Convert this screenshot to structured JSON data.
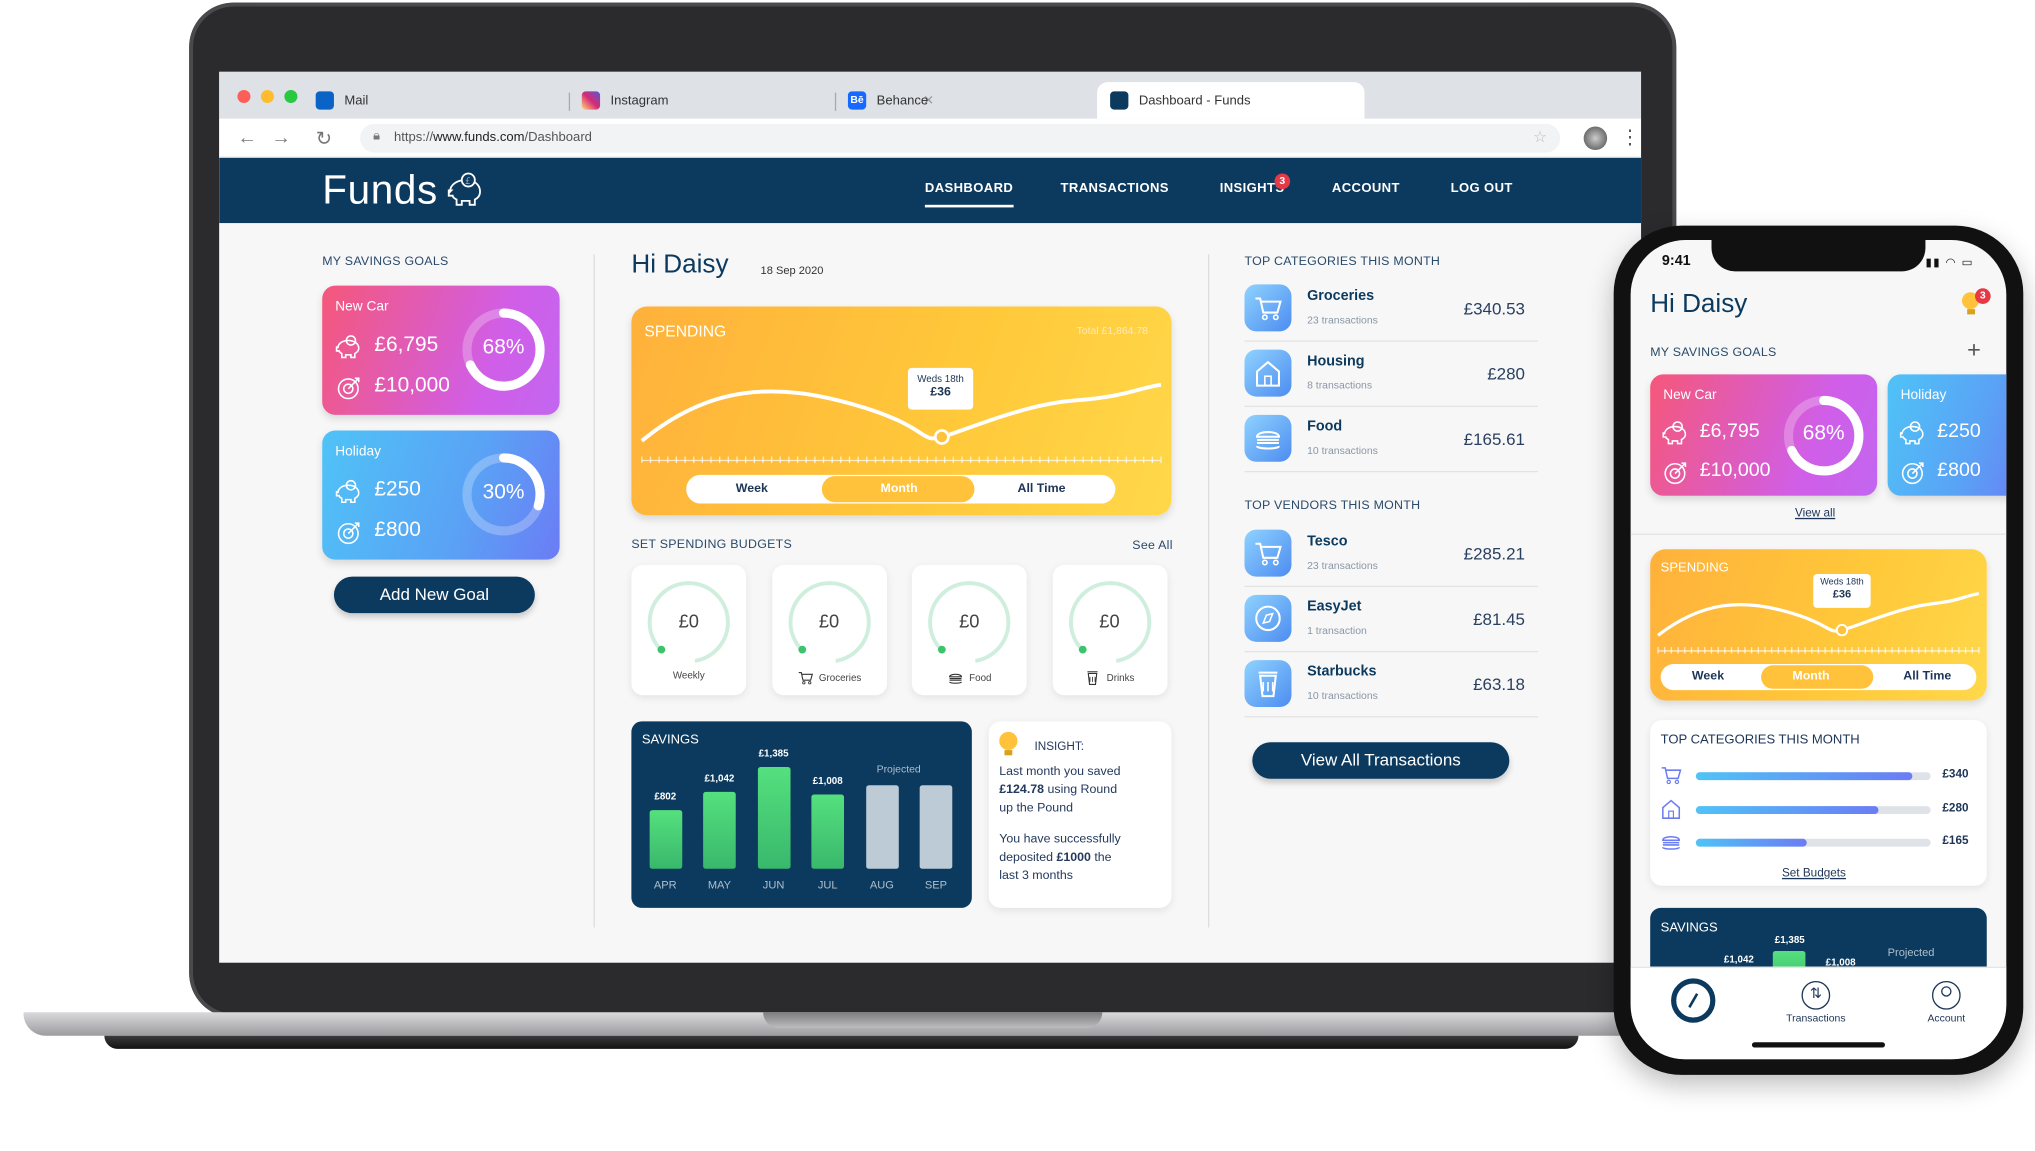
{
  "browser": {
    "tabs": [
      {
        "label": "Mail",
        "color": "#0a64c8"
      },
      {
        "label": "Instagram",
        "color": "#d6249f"
      },
      {
        "label": "Behance",
        "color": "#1769ff"
      },
      {
        "label": "Dashboard - Funds",
        "color": "#0c3a5e"
      }
    ],
    "url_prefix": "https://",
    "url_domain": "www.funds.com",
    "url_path": "/Dashboard"
  },
  "app": {
    "logo": "Funds",
    "nav": [
      "DASHBOARD",
      "TRANSACTIONS",
      "INSIGHTS",
      "ACCOUNT",
      "LOG OUT"
    ],
    "insights_badge": "3",
    "greeting": "Hi Daisy",
    "date": "18 Sep 2020"
  },
  "savings_goals": {
    "title": "MY SAVINGS GOALS",
    "goals": [
      {
        "name": "New Car",
        "saved": "£6,795",
        "target": "£10,000",
        "percent": "68%",
        "fraction": 0.68
      },
      {
        "name": "Holiday",
        "saved": "£250",
        "target": "£800",
        "percent": "30%",
        "fraction": 0.3
      }
    ],
    "add_button": "Add New Goal"
  },
  "spending": {
    "title": "SPENDING",
    "total": "Total £1,864.78",
    "tooltip_day": "Weds 18th",
    "tooltip_amount": "£36",
    "ranges": [
      "Week",
      "Month",
      "All Time"
    ],
    "selected": "Month"
  },
  "budgets": {
    "title": "SET SPENDING BUDGETS",
    "see_all": "See All",
    "items": [
      {
        "amount": "£0",
        "label": "Weekly",
        "icon": "none"
      },
      {
        "amount": "£0",
        "label": "Groceries",
        "icon": "cart-icon"
      },
      {
        "amount": "£0",
        "label": "Food",
        "icon": "burger-icon"
      },
      {
        "amount": "£0",
        "label": "Drinks",
        "icon": "drink-icon"
      }
    ]
  },
  "savings_chart": {
    "title": "SAVINGS",
    "projected_label": "Projected"
  },
  "chart_data": {
    "type": "bar",
    "title": "SAVINGS",
    "categories": [
      "APR",
      "MAY",
      "JUN",
      "JUL",
      "AUG",
      "SEP"
    ],
    "values": [
      802,
      1042,
      1385,
      1008,
      null,
      null
    ],
    "value_labels": [
      "£802",
      "£1,042",
      "£1,385",
      "£1,008",
      "",
      ""
    ],
    "projected": [
      false,
      false,
      false,
      false,
      true,
      true
    ],
    "ylim": [
      0,
      1500
    ]
  },
  "insight": {
    "title": "INSIGHT:",
    "line1": "Last month you saved",
    "amount1": "£124.78",
    "line2": " using Round",
    "line3": "up the Pound",
    "line4": "You have successfully",
    "line5": "deposited ",
    "amount2": "£1000",
    "line6": " the",
    "line7": "last 3 months"
  },
  "top_categories": {
    "title": "TOP CATEGORIES THIS MONTH",
    "items": [
      {
        "name": "Groceries",
        "sub": "23 transactions",
        "amount": "£340.53",
        "icon": "cart-icon"
      },
      {
        "name": "Housing",
        "sub": "8 transactions",
        "amount": "£280",
        "icon": "house-icon"
      },
      {
        "name": "Food",
        "sub": "10 transactions",
        "amount": "£165.61",
        "icon": "burger-icon"
      }
    ]
  },
  "top_vendors": {
    "title": "TOP VENDORS THIS MONTH",
    "items": [
      {
        "name": "Tesco",
        "sub": "23 transactions",
        "amount": "£285.21",
        "icon": "cart-icon"
      },
      {
        "name": "EasyJet",
        "sub": "1 transaction",
        "amount": "£81.45",
        "icon": "compass-icon"
      },
      {
        "name": "Starbucks",
        "sub": "10 transactions",
        "amount": "£63.18",
        "icon": "cup-icon"
      }
    ],
    "view_all": "View All Transactions"
  },
  "phone": {
    "time": "9:41",
    "greeting": "Hi Daisy",
    "badge": "3",
    "goals_title": "MY SAVINGS GOALS",
    "view_all": "View all",
    "spending_title": "SPENDING",
    "tooltip_day": "Weds 18th",
    "tooltip_amount": "£36",
    "ranges": [
      "Week",
      "Month",
      "All Time"
    ],
    "categories_title": "TOP CATEGORIES THIS MONTH",
    "categories": [
      {
        "amount": "£340",
        "fraction": 0.92,
        "icon": "cart-icon"
      },
      {
        "amount": "£280",
        "fraction": 0.78,
        "icon": "house-icon"
      },
      {
        "amount": "£165",
        "fraction": 0.47,
        "icon": "burger-icon"
      }
    ],
    "set_budgets": "Set Budgets",
    "savings_title": "SAVINGS",
    "savings_labels": [
      "£1,042",
      "£1,385",
      "£1,008"
    ],
    "projected": "Projected",
    "tabbar": [
      "Transactions",
      "Account"
    ]
  }
}
